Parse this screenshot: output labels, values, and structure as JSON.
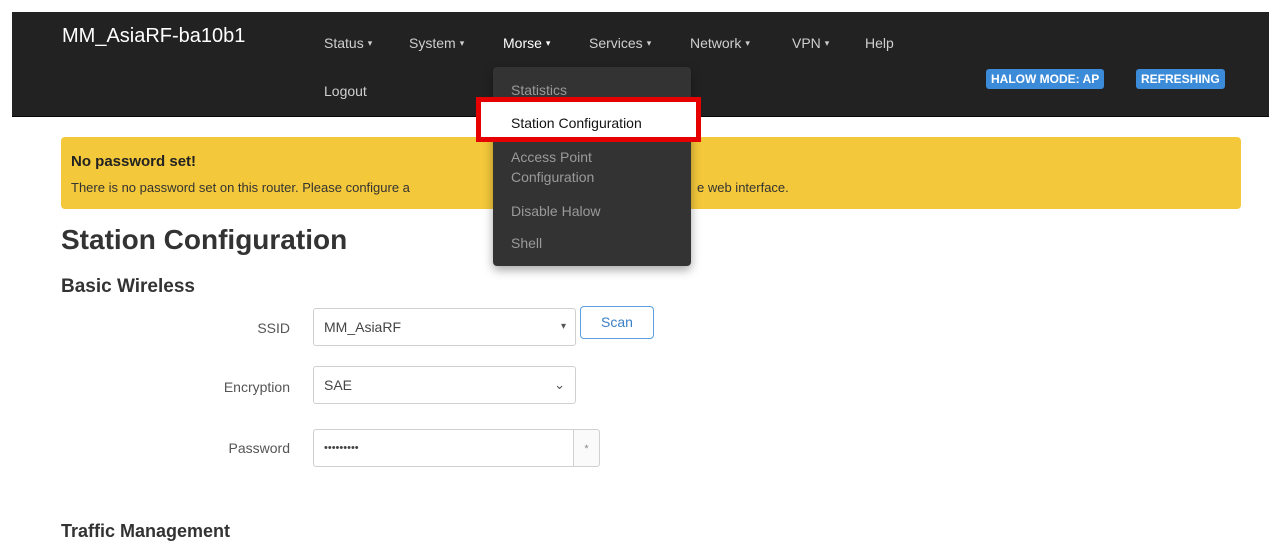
{
  "navbar": {
    "brand": "MM_AsiaRF-ba10b1",
    "items": [
      {
        "label": "Status",
        "caret": "▾"
      },
      {
        "label": "System",
        "caret": "▾"
      },
      {
        "label": "Morse",
        "caret": "▾"
      },
      {
        "label": "Services",
        "caret": "▾"
      },
      {
        "label": "Network",
        "caret": "▾"
      },
      {
        "label": "VPN",
        "caret": "▾"
      },
      {
        "label": "Help",
        "caret": ""
      }
    ],
    "logout": "Logout",
    "badges": [
      "HALOW MODE: AP",
      "REFRESHING"
    ],
    "badge_color": "#3b8bd9"
  },
  "dropdown": {
    "items": [
      {
        "label": "Statistics"
      },
      {
        "label": "Station Configuration"
      },
      {
        "label": "Access Point Configuration"
      },
      {
        "label": "Disable Halow"
      },
      {
        "label": "Shell"
      }
    ],
    "highlight_color": "#e60000"
  },
  "alert": {
    "title": "No password set!",
    "text_start": "There is no password set on this router. Please configure a",
    "text_end": "e web interface.",
    "color": "#f3c83a"
  },
  "page": {
    "title": "Station Configuration",
    "sections": {
      "basic": "Basic Wireless",
      "traffic": "Traffic Management"
    }
  },
  "form": {
    "ssid": {
      "label": "SSID",
      "value": "MM_AsiaRF",
      "arrow": "▾",
      "scan_label": "Scan"
    },
    "encryption": {
      "label": "Encryption",
      "value": "SAE",
      "chevron": "⌄"
    },
    "password": {
      "label": "Password",
      "value": "•••••••••",
      "toggle": "*"
    }
  }
}
